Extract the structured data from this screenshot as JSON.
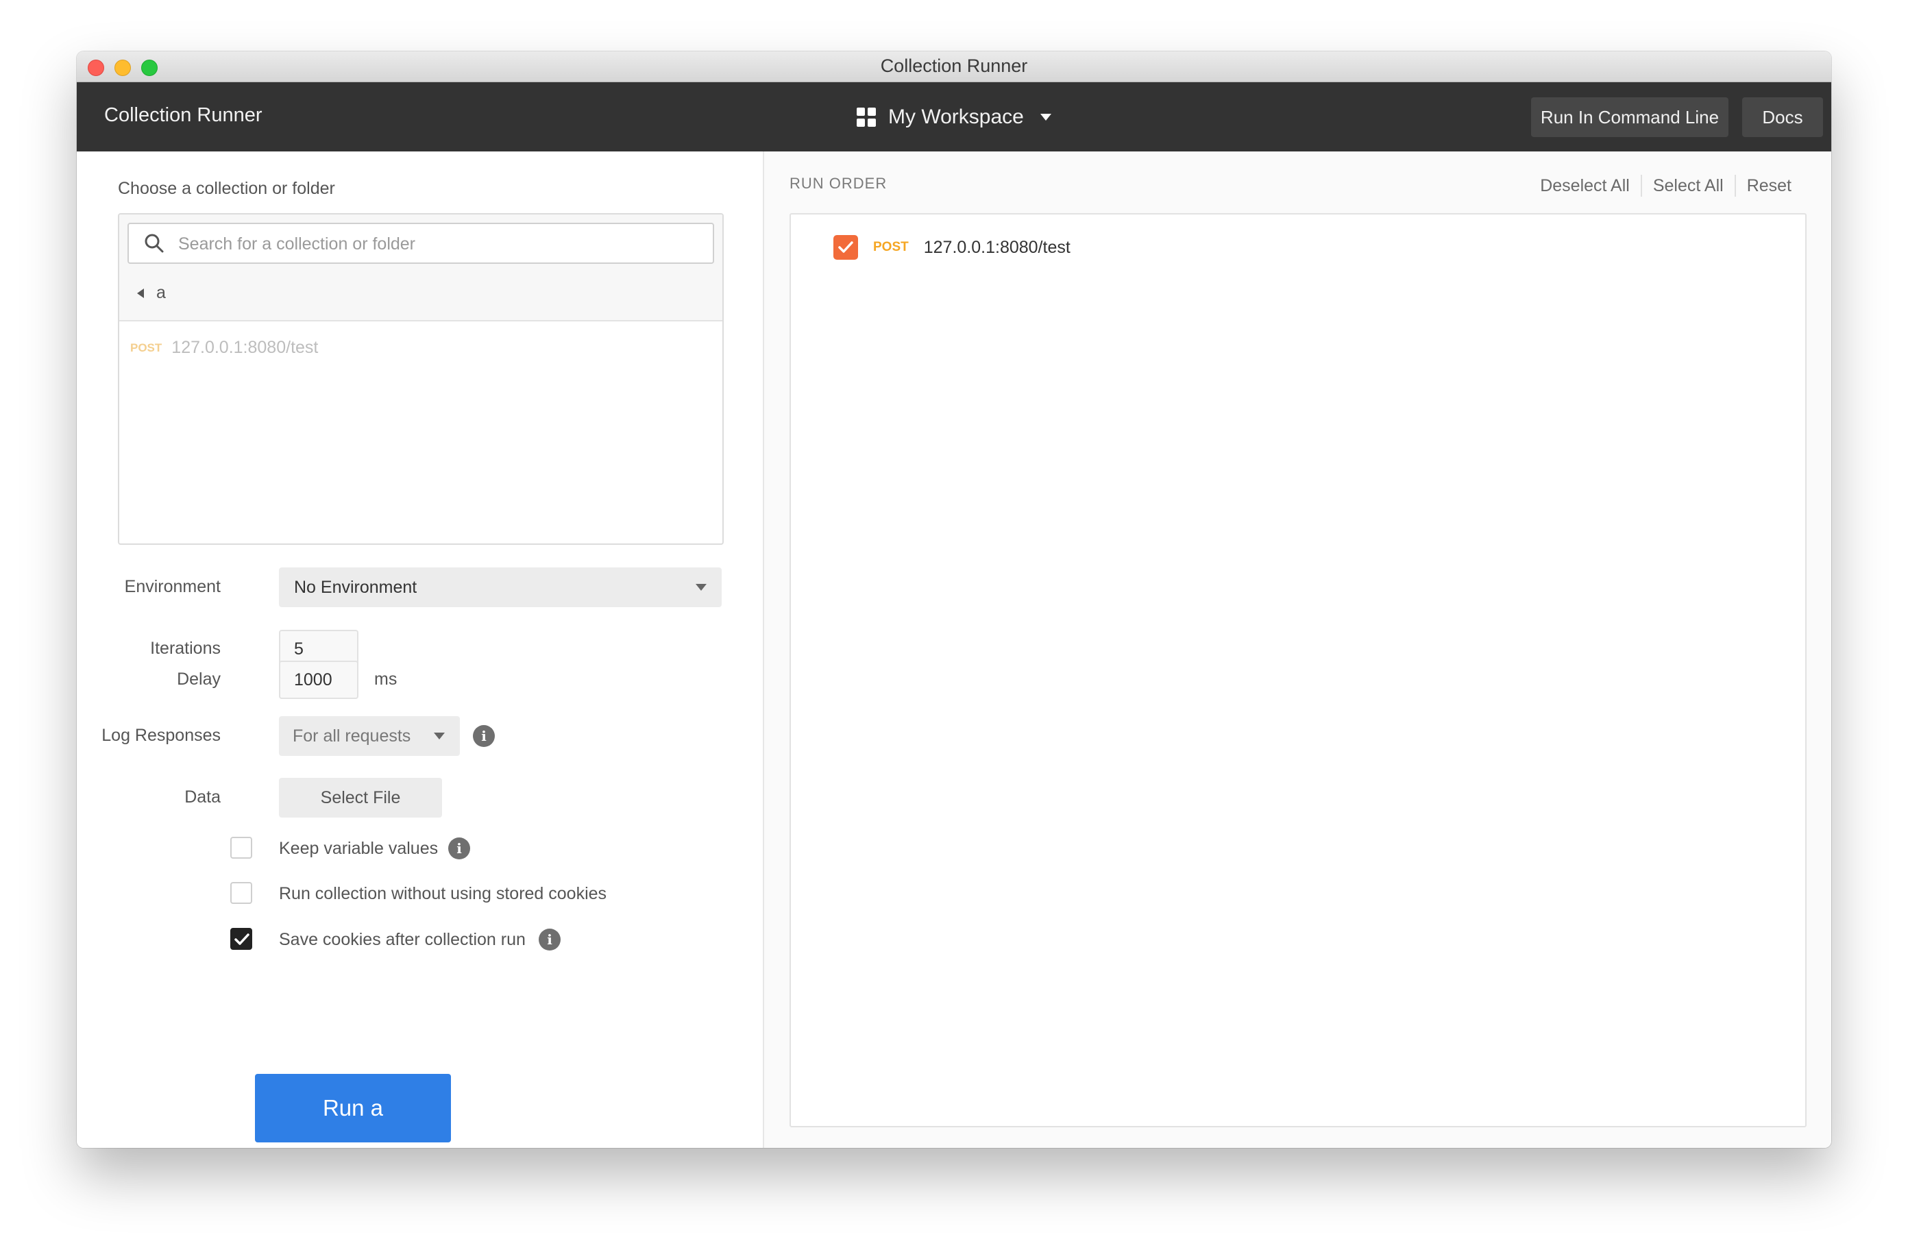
{
  "window": {
    "title": "Collection Runner"
  },
  "appbar": {
    "title": "Collection Runner",
    "workspace": "My Workspace",
    "run_cli_label": "Run In Command Line",
    "docs_label": "Docs"
  },
  "left": {
    "choose_label": "Choose a collection or folder",
    "search_placeholder": "Search for a collection or folder",
    "current_folder": "a",
    "requests": [
      {
        "method": "POST",
        "url": "127.0.0.1:8080/test"
      }
    ],
    "environment": {
      "label": "Environment",
      "value": "No Environment"
    },
    "iterations": {
      "label": "Iterations",
      "value": "5"
    },
    "delay": {
      "label": "Delay",
      "value": "1000",
      "unit": "ms"
    },
    "log_responses": {
      "label": "Log Responses",
      "value": "For all requests"
    },
    "data": {
      "label": "Data",
      "button": "Select File"
    },
    "options": [
      {
        "label": "Keep variable values",
        "checked": false
      },
      {
        "label": "Run collection without using stored cookies",
        "checked": false
      },
      {
        "label": "Save cookies after collection run",
        "checked": true
      }
    ],
    "run_button": "Run a"
  },
  "right": {
    "title": "RUN ORDER",
    "deselect_all": "Deselect All",
    "select_all": "Select All",
    "reset": "Reset",
    "items": [
      {
        "method": "POST",
        "url": "127.0.0.1:8080/test",
        "checked": true
      }
    ]
  },
  "colors": {
    "appbar_bg": "#333333",
    "run_button": "#2f7fe6",
    "checkbox_orange": "#f26b3a",
    "method_post": "#f5a623"
  }
}
